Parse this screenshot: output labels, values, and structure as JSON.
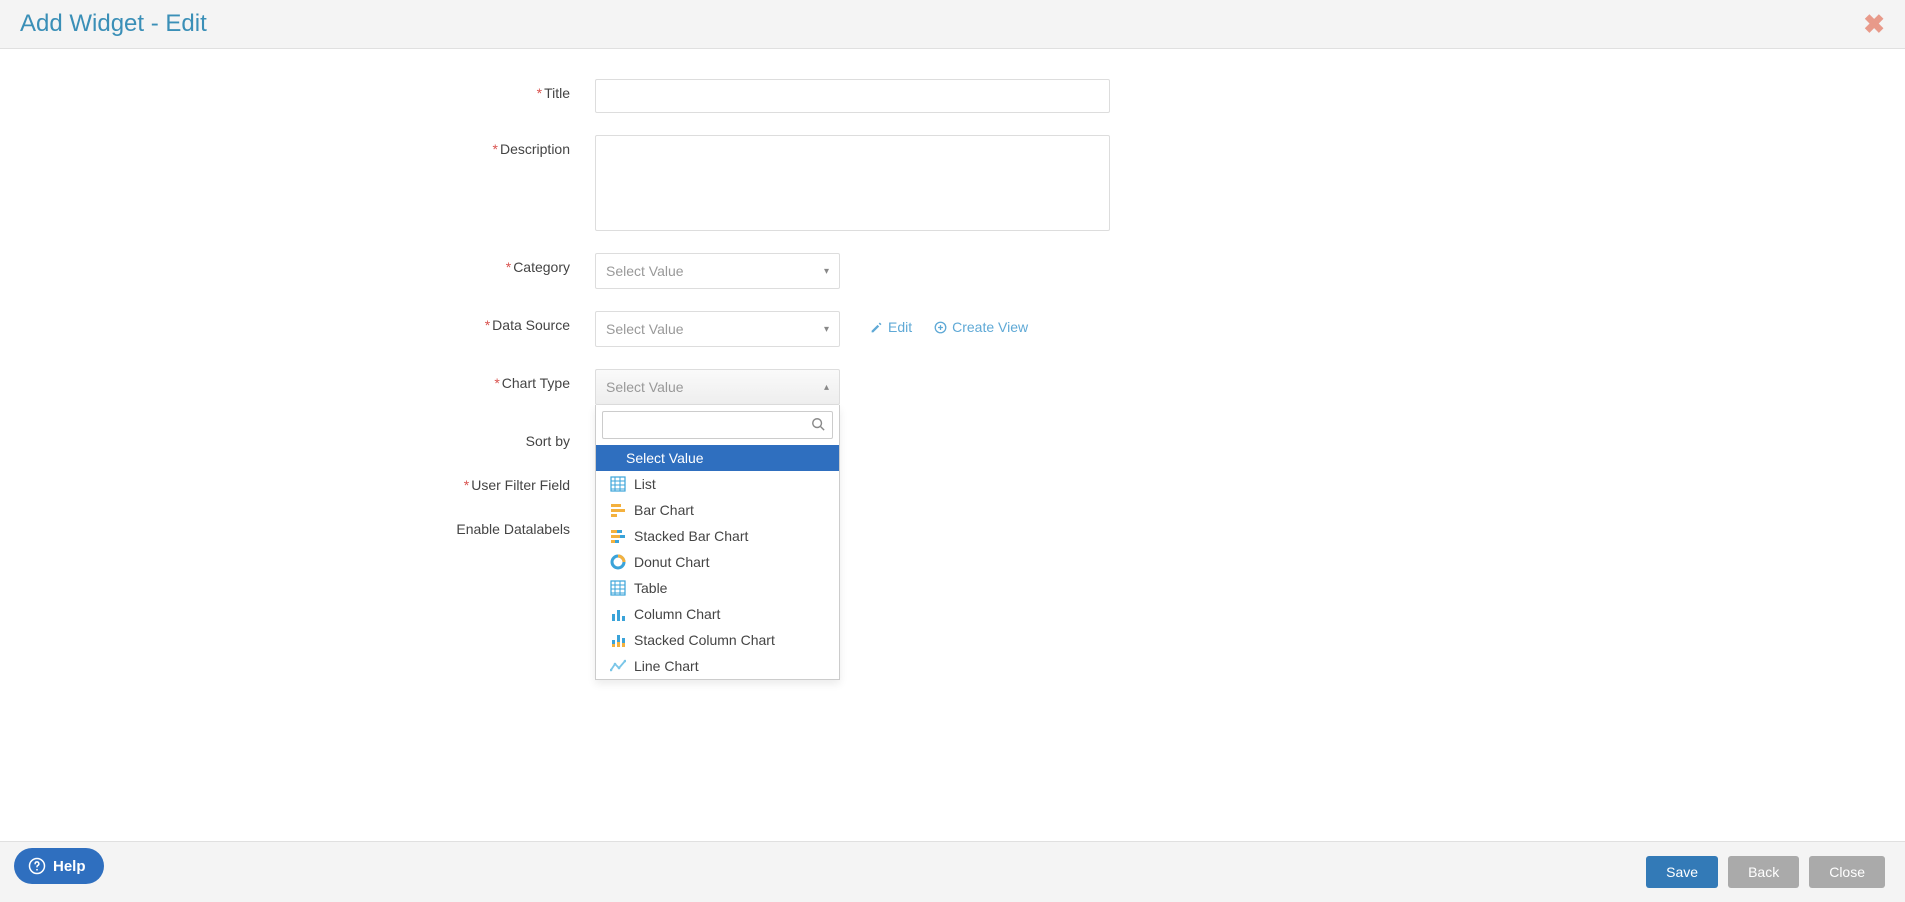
{
  "header": {
    "title": "Add Widget - Edit"
  },
  "form": {
    "title_label": "Title",
    "description_label": "Description",
    "category_label": "Category",
    "datasource_label": "Data Source",
    "charttype_label": "Chart Type",
    "sortby_label": "Sort by",
    "userfilter_label": "User Filter Field",
    "datalabels_label": "Enable Datalabels",
    "select_placeholder": "Select Value",
    "title_value": "",
    "description_value": "",
    "edit_link": "Edit",
    "create_view_link": "Create View"
  },
  "chart_type_options": [
    {
      "label": "Select Value",
      "icon": ""
    },
    {
      "label": "List",
      "icon": "list"
    },
    {
      "label": "Bar Chart",
      "icon": "bar"
    },
    {
      "label": "Stacked Bar Chart",
      "icon": "stackedbar"
    },
    {
      "label": "Donut Chart",
      "icon": "donut"
    },
    {
      "label": "Table",
      "icon": "table"
    },
    {
      "label": "Column Chart",
      "icon": "column"
    },
    {
      "label": "Stacked Column Chart",
      "icon": "stackedcolumn"
    },
    {
      "label": "Line Chart",
      "icon": "line"
    }
  ],
  "footer": {
    "save": "Save",
    "back": "Back",
    "close": "Close"
  },
  "help": {
    "label": "Help"
  }
}
